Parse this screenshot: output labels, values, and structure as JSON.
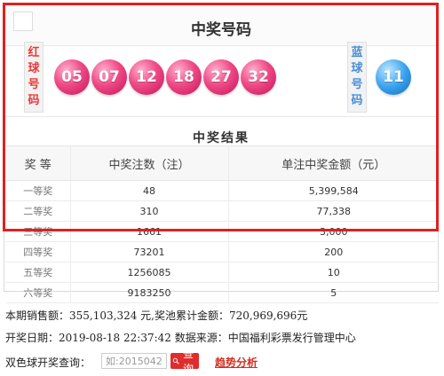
{
  "panel": {
    "title": "中奖号码",
    "red_label": [
      "红",
      "球",
      "号",
      "码"
    ],
    "blue_label": [
      "蓝",
      "球",
      "号",
      "码"
    ],
    "red_balls": [
      "05",
      "07",
      "12",
      "18",
      "27",
      "32"
    ],
    "blue_ball": "11",
    "results_title": "中奖结果"
  },
  "table": {
    "headers": [
      "奖 等",
      "中奖注数（注）",
      "单注中奖金额（元）"
    ],
    "rows": [
      [
        "一等奖",
        "48",
        "5,399,584"
      ],
      [
        "二等奖",
        "310",
        "77,338"
      ],
      [
        "三等奖",
        "1661",
        "3,000"
      ],
      [
        "四等奖",
        "73201",
        "200"
      ],
      [
        "五等奖",
        "1256085",
        "10"
      ],
      [
        "六等奖",
        "9183250",
        "5"
      ]
    ]
  },
  "info": {
    "sales_line": "本期销售额：355,103,324 元,奖池累计金额：720,969,696元",
    "date_line": "开奖日期：2019-08-18 22:37:42 数据来源：中国福利彩票发行管理中心"
  },
  "query": {
    "label": "双色球开奖查询：",
    "placeholder": "如:2015042",
    "button": "查询",
    "trend_link": "趋势分析"
  },
  "colors": {
    "highlight_border": "#e02020",
    "red_ball": "#ef4a86",
    "blue_ball": "#3ba3ef",
    "query_button": "#e02c2c"
  }
}
